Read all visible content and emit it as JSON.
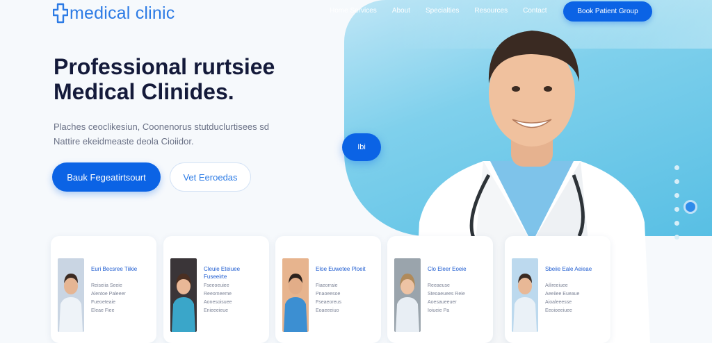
{
  "brand": {
    "name": "medical clinic",
    "color": "#2c7be5"
  },
  "nav": {
    "items": [
      "Home Services",
      "About",
      "Specialties",
      "Resources",
      "Contact"
    ],
    "cta": "Book Patient Group"
  },
  "hero": {
    "title_line1": "Professional rurtsiee",
    "title_line2": "Medical Clinides.",
    "subtitle_line1": "Plaches ceoclikesiun, Coonenorus stutduclurtisees sd",
    "subtitle_line2": "Nattire ekeidmeaste deola Cioiidor.",
    "primary_button": "Bauk Fegeatirtsourt",
    "secondary_button": "Vet Eeroedas",
    "float_badge": "Ibi"
  },
  "doctors": [
    {
      "name": "Euri Becsree Tiikie",
      "info": [
        "Reiseiia Seeie",
        "Alentoe Paleeer",
        "Fueoeteaie",
        "Eleae Fiee"
      ],
      "photo_bg": "#c9d5e3",
      "scrub": "#eef3f8"
    },
    {
      "name": "Cleuie Eteiuee Fuseeirte",
      "info": [
        "Fseeoeuiee",
        "Reeomeeme",
        "Aonesoisuee",
        "Enieeeieue"
      ],
      "photo_bg": "#3a3538",
      "scrub": "#3aa6c9"
    },
    {
      "name": "Eloe Euwetee Ploeit",
      "info": [
        "Fiaeorraie",
        "Pnaoeesoe",
        "Fseaeoreus",
        "Eoaeeeiuo"
      ],
      "photo_bg": "#e7b48e",
      "scrub": "#3c8fd2"
    },
    {
      "name": "Clo Eleer Eoeie",
      "info": [
        "Reeaeuse",
        "Steoaeuees Reie",
        "Aoesaueeuer",
        "Ioiueie Pa"
      ],
      "photo_bg": "#9aa4ac",
      "scrub": "#e8eef4"
    },
    {
      "name": "Sbeiie Eale Aeieae",
      "info": [
        "Ailireeiuee",
        "Aeeiiee Eueaue",
        "Aioaleeesse",
        "Eeoioeeiuee"
      ],
      "photo_bg": "#bcd9ee",
      "scrub": "#eaf1f7"
    }
  ],
  "colors": {
    "accent": "#0b63e5",
    "hero_bg": "#7fd0ec",
    "headline": "#141a3a"
  }
}
